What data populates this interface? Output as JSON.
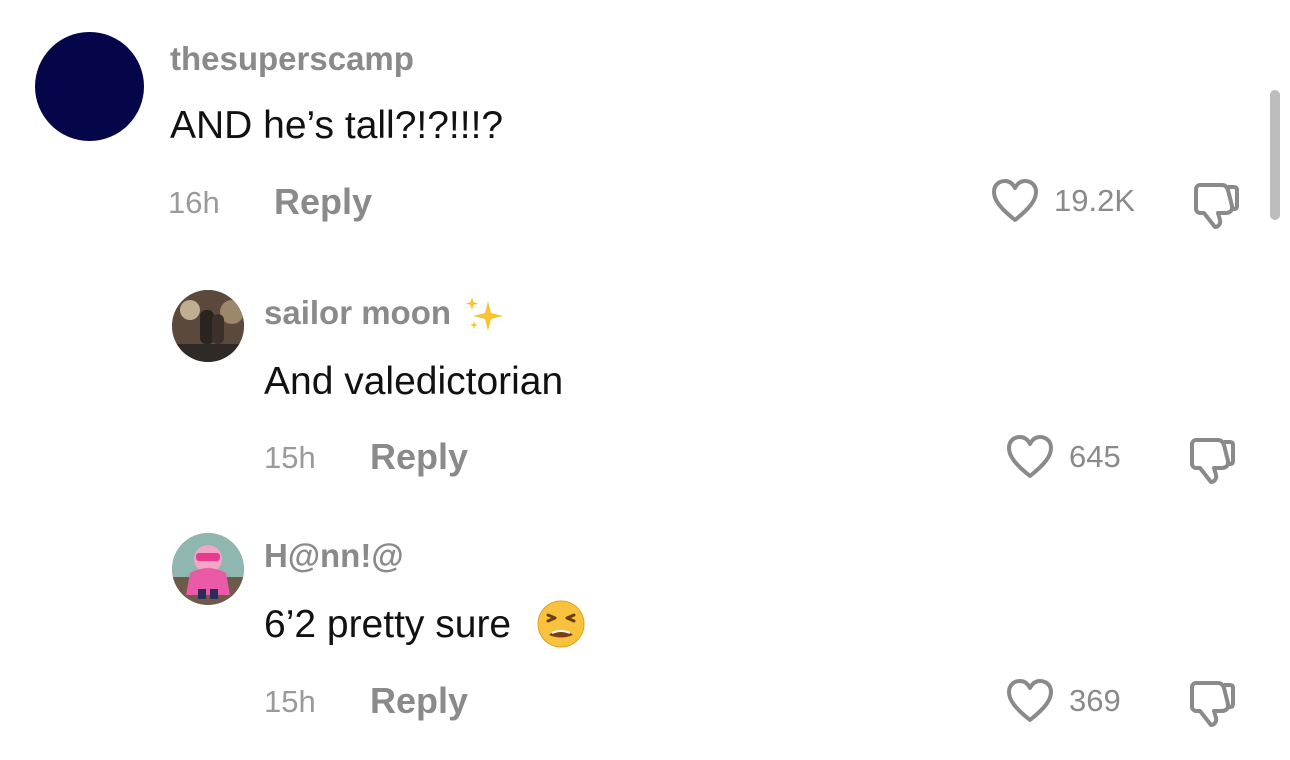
{
  "comments": [
    {
      "username": "thesuperscamp",
      "text": "AND he’s tall?!?!!!?",
      "time": "16h",
      "reply_label": "Reply",
      "likes": "19.2K",
      "avatar_icon": "solid-avatar"
    },
    {
      "username": "sailor moon",
      "username_emoji_icon": "sparkles-icon",
      "text": "And valedictorian",
      "time": "15h",
      "reply_label": "Reply",
      "likes": "645",
      "avatar_icon": "photo-avatar"
    },
    {
      "username": "H@nn!@",
      "text": "6’2 pretty sure",
      "text_emoji_icon": "tired-face-emoji",
      "time": "15h",
      "reply_label": "Reply",
      "likes": "369",
      "avatar_icon": "cartoon-avatar"
    }
  ],
  "colors": {
    "avatar_main": "#05064a",
    "username": "#8a8a8a",
    "text": "#111111",
    "meta": "#9a9a9a"
  }
}
